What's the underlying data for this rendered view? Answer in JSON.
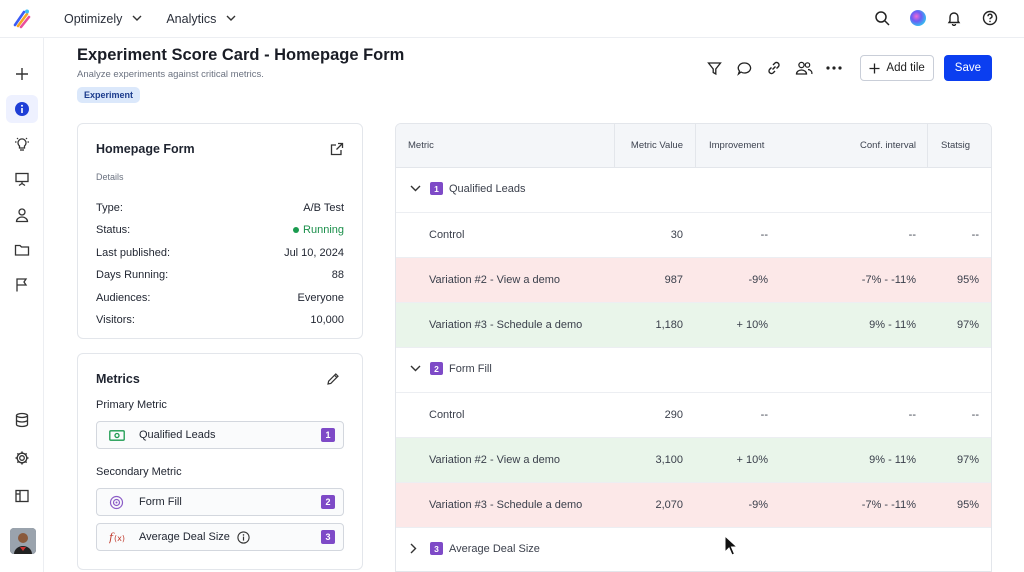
{
  "topbar": {
    "menus": [
      {
        "label": "Optimizely"
      },
      {
        "label": "Analytics"
      }
    ]
  },
  "header": {
    "title": "Experiment Score Card - Homepage Form",
    "subtitle": "Analyze experiments against critical metrics.",
    "badge": "Experiment"
  },
  "toolbar": {
    "add_tile_label": "Add tile",
    "save_label": "Save"
  },
  "details": {
    "title": "Homepage Form",
    "section": "Details",
    "rows": [
      {
        "key": "Type:",
        "value": "A/B Test"
      },
      {
        "key": "Status:",
        "value": "Running"
      },
      {
        "key": "Last published:",
        "value": "Jul 10, 2024"
      },
      {
        "key": "Days Running:",
        "value": "88"
      },
      {
        "key": "Audiences:",
        "value": "Everyone"
      },
      {
        "key": "Visitors:",
        "value": "10,000"
      }
    ]
  },
  "metrics": {
    "title": "Metrics",
    "primary_label": "Primary Metric",
    "secondary_label": "Secondary Metric",
    "primary": [
      {
        "name": "Qualified Leads",
        "num": "1"
      }
    ],
    "secondary": [
      {
        "name": "Form Fill",
        "num": "2"
      },
      {
        "name": "Average Deal Size",
        "num": "3"
      }
    ]
  },
  "table": {
    "headers": [
      "Metric",
      "Metric Value",
      "Improvement",
      "Conf. interval",
      "Statsig"
    ],
    "groups": [
      {
        "num": "1",
        "name": "Qualified Leads",
        "rows": [
          {
            "name": "Control",
            "value": "30",
            "improvement": "--",
            "conf": "--",
            "statsig": "--"
          },
          {
            "name": "Variation #2 - View a demo",
            "value": "987",
            "improvement": "-9%",
            "conf": "-7% - -11%",
            "statsig": "95%"
          },
          {
            "name": "Variation #3 - Schedule a demo",
            "value": "1,180",
            "improvement": "+ 10%",
            "conf": "9% - 11%",
            "statsig": "97%"
          }
        ]
      },
      {
        "num": "2",
        "name": "Form Fill",
        "rows": [
          {
            "name": "Control",
            "value": "290",
            "improvement": "--",
            "conf": "--",
            "statsig": "--"
          },
          {
            "name": "Variation #2 - View a demo",
            "value": "3,100",
            "improvement": "+ 10%",
            "conf": "9% - 11%",
            "statsig": "97%"
          },
          {
            "name": "Variation #3 - Schedule a demo",
            "value": "2,070",
            "improvement": "-9%",
            "conf": "-7% - -11%",
            "statsig": "95%"
          }
        ]
      },
      {
        "num": "3",
        "name": "Average Deal Size",
        "rows": []
      }
    ]
  },
  "colors": {
    "accent": "#0b3ef0",
    "metric_badge": "#7e4ac7",
    "negative_row": "#fce8e8",
    "positive_row": "#e9f5ea",
    "running": "#1a8f4a"
  },
  "icons": {
    "top": [
      "search-icon",
      "ai-assistant-icon",
      "bell-icon",
      "help-icon"
    ],
    "left": [
      "plus-icon",
      "info-icon",
      "lightbulb-icon",
      "presentation-icon",
      "user-icon",
      "folder-icon",
      "flag-icon",
      "database-icon",
      "gear-icon",
      "layout-icon"
    ],
    "toolbar": [
      "filter-icon",
      "comment-icon",
      "link-icon",
      "users-icon",
      "more-icon"
    ]
  }
}
